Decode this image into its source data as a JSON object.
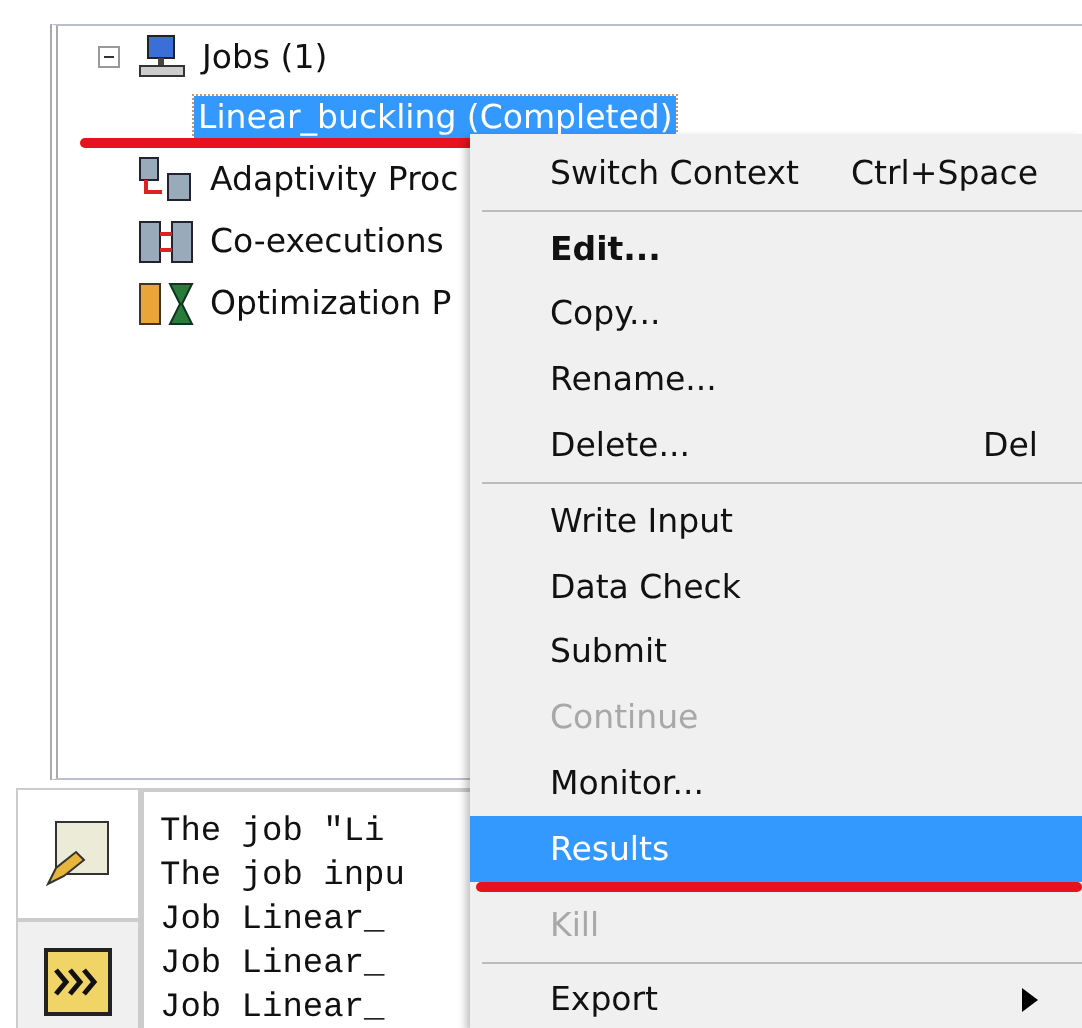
{
  "tree": [
    {
      "label": "Jobs (1)",
      "expanded": true,
      "selected": false,
      "children": [
        {
          "label": "Linear_buckling (Completed)",
          "selected": true
        }
      ]
    },
    {
      "label": "Adaptivity Proc",
      "selected": false
    },
    {
      "label": "Co-executions",
      "selected": false
    },
    {
      "label": "Optimization P",
      "selected": false
    }
  ],
  "context_menu": [
    {
      "kind": "item",
      "label": "Switch Context",
      "shortcut": "Ctrl+Space",
      "bold": false,
      "disabled": false,
      "selected": false
    },
    {
      "kind": "separator"
    },
    {
      "kind": "item",
      "label": "Edit...",
      "bold": true,
      "disabled": false,
      "selected": false
    },
    {
      "kind": "item",
      "label": "Copy...",
      "bold": false,
      "disabled": false,
      "selected": false
    },
    {
      "kind": "item",
      "label": "Rename...",
      "bold": false,
      "disabled": false,
      "selected": false
    },
    {
      "kind": "item",
      "label": "Delete...",
      "shortcut": "Del",
      "bold": false,
      "disabled": false,
      "selected": false
    },
    {
      "kind": "separator"
    },
    {
      "kind": "item",
      "label": "Write Input",
      "bold": false,
      "disabled": false,
      "selected": false
    },
    {
      "kind": "item",
      "label": "Data Check",
      "bold": false,
      "disabled": false,
      "selected": false
    },
    {
      "kind": "item",
      "label": "Submit",
      "bold": false,
      "disabled": false,
      "selected": false
    },
    {
      "kind": "item",
      "label": "Continue",
      "bold": false,
      "disabled": true,
      "selected": false
    },
    {
      "kind": "item",
      "label": "Monitor...",
      "bold": false,
      "disabled": false,
      "selected": false
    },
    {
      "kind": "item",
      "label": "Results",
      "bold": false,
      "disabled": false,
      "selected": true
    },
    {
      "kind": "item",
      "label": "Kill",
      "bold": false,
      "disabled": true,
      "selected": false
    },
    {
      "kind": "separator"
    },
    {
      "kind": "item",
      "label": "Export",
      "bold": false,
      "disabled": false,
      "selected": false,
      "submenu": true
    }
  ],
  "message_area": {
    "lines": [
      "The job \"Li",
      "The job inpu",
      "Job Linear_",
      "Job Linear_",
      "Job Linear_"
    ]
  }
}
